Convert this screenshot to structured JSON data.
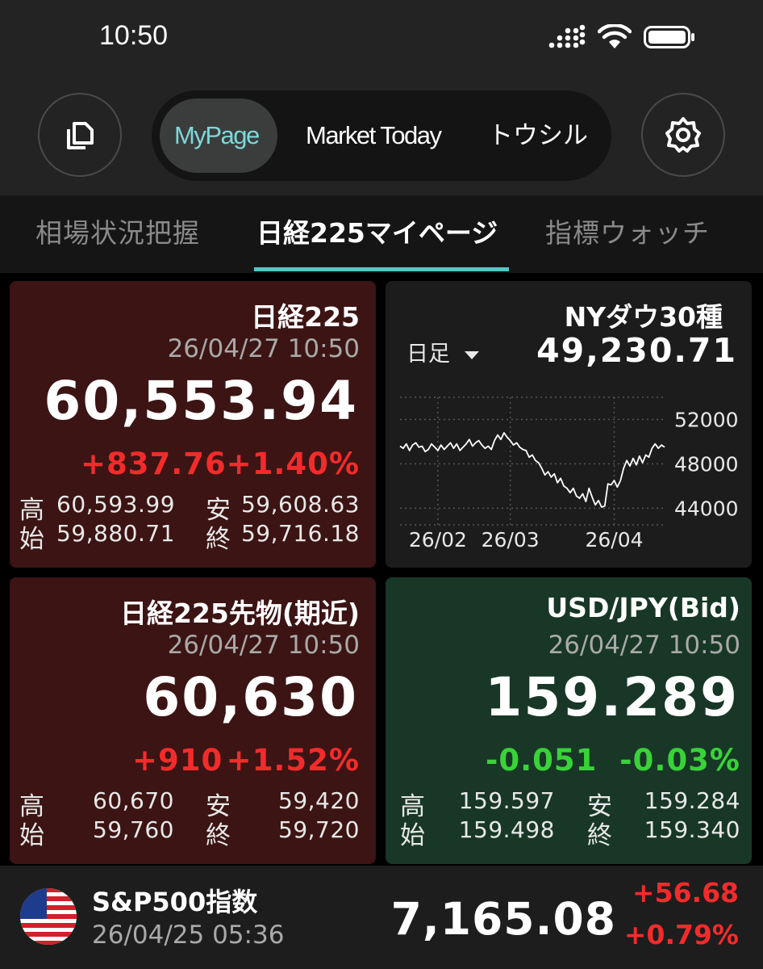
{
  "status_bar": {
    "time": "10:50"
  },
  "header": {
    "tabs": [
      {
        "label": "MyPage",
        "active": true,
        "color": "#7fd8d8"
      },
      {
        "label": "Market Today",
        "active": false
      },
      {
        "label": "トウシル",
        "active": false
      }
    ],
    "left_icon": "document-copy-icon",
    "right_icon": "settings-gear-icon"
  },
  "sub_tabs": [
    {
      "label": "相場状況把握",
      "active": false
    },
    {
      "label": "日経225マイページ",
      "active": true
    },
    {
      "label": "指標ウォッチ",
      "active": false
    }
  ],
  "cards": {
    "nikkei": {
      "title": "日経225",
      "datetime": "26/04/27 10:50",
      "price": "60,553.94",
      "change": "+837.76",
      "change_pct": "+1.40%",
      "high_label": "高",
      "high": "60,593.99",
      "low_label": "安",
      "low": "59,608.63",
      "open_label": "始",
      "open": "59,880.71",
      "close_label": "終",
      "close": "59,716.18"
    },
    "nydow": {
      "title": "NYダウ30種",
      "period": "日足",
      "price": "49,230.71"
    },
    "futures": {
      "title": "日経225先物(期近)",
      "datetime": "26/04/27 10:50",
      "price": "60,630",
      "change": "+910",
      "change_pct": "+1.52%",
      "high_label": "高",
      "high": "60,670",
      "low_label": "安",
      "low": "59,420",
      "open_label": "始",
      "open": "59,760",
      "close_label": "終",
      "close": "59,720"
    },
    "usdjpy": {
      "title": "USD/JPY(Bid)",
      "datetime": "26/04/27 10:50",
      "price": "159.289",
      "change": "-0.051",
      "change_pct": "-0.03%",
      "high_label": "高",
      "high": "159.597",
      "low_label": "安",
      "low": "159.284",
      "open_label": "始",
      "open": "159.498",
      "close_label": "終",
      "close": "159.340"
    }
  },
  "bottom_row": {
    "flag_icon": "us-flag-icon",
    "title": "S&P500指数",
    "datetime": "26/04/25 05:36",
    "price": "7,165.08",
    "change": "+56.68",
    "change_pct": "+0.79%"
  },
  "chart_data": {
    "type": "line",
    "ylim": [
      42500,
      54000
    ],
    "yticks": [
      "52000",
      "48000",
      "44000"
    ],
    "ytick_values": [
      52000,
      48000,
      44000
    ],
    "xticks": [
      "26/02",
      "26/03",
      "26/04"
    ],
    "xtick_index": [
      12,
      35,
      68
    ],
    "grid": true,
    "line_color": "#ffffff",
    "series": [
      {
        "values": [
          49600,
          49400,
          49800,
          49200,
          49700,
          49900,
          49500,
          49600,
          49100,
          49300,
          49800,
          49500,
          49200,
          49700,
          49300,
          49600,
          49900,
          49400,
          49800,
          49200,
          49500,
          49800,
          50200,
          49600,
          49900,
          50100,
          49700,
          49400,
          49600,
          49300,
          50100,
          50600,
          50200,
          50800,
          50400,
          50100,
          49700,
          49900,
          49500,
          49300,
          49200,
          48600,
          48800,
          48300,
          48100,
          47600,
          47000,
          47300,
          46800,
          47100,
          46300,
          46700,
          46000,
          45800,
          45400,
          45800,
          45100,
          44900,
          45300,
          44600,
          45800,
          45000,
          44300,
          44700,
          44100,
          44200,
          46200,
          46100,
          46500,
          45900,
          46500,
          47600,
          48300,
          47800,
          48500,
          47900,
          48700,
          48100,
          48800,
          48600,
          49400,
          49800,
          49400,
          49700,
          49500
        ]
      }
    ]
  }
}
